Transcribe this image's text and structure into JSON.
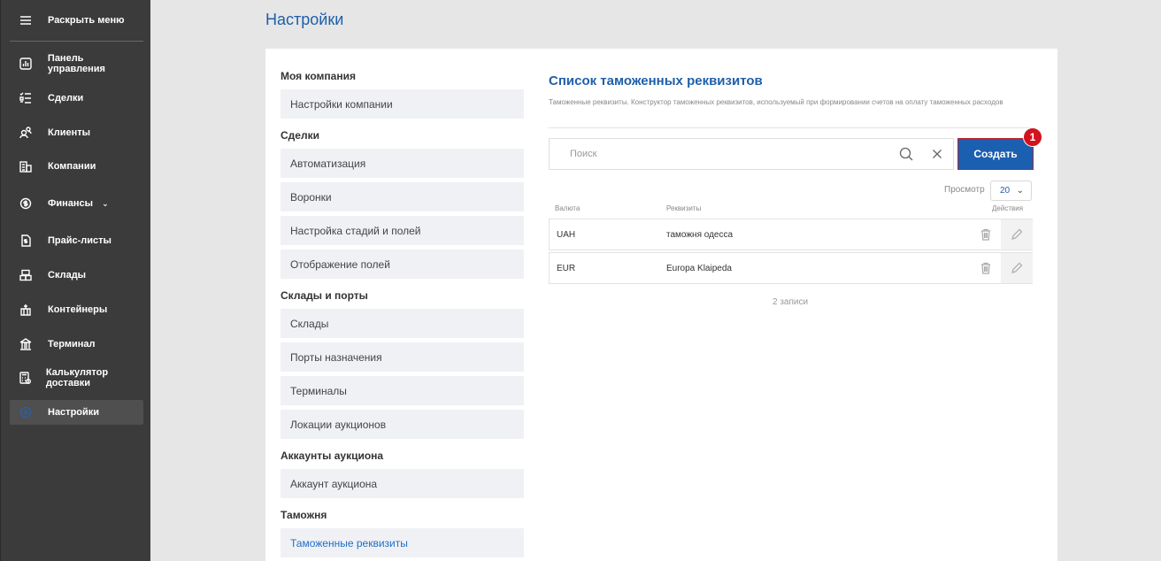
{
  "sidebar": {
    "toggle_label": "Раскрыть меню",
    "items": [
      {
        "label": "Панель управления",
        "icon": "dashboard-icon"
      },
      {
        "label": "Сделки",
        "icon": "deals-icon"
      },
      {
        "label": "Клиенты",
        "icon": "clients-icon"
      },
      {
        "label": "Компании",
        "icon": "companies-icon"
      },
      {
        "label": "Финансы",
        "icon": "finance-icon"
      },
      {
        "label": "Прайс-листы",
        "icon": "pricelist-icon"
      },
      {
        "label": "Склады",
        "icon": "warehouse-icon"
      },
      {
        "label": "Контейнеры",
        "icon": "containers-icon"
      },
      {
        "label": "Терминал",
        "icon": "terminal-icon"
      },
      {
        "label": "Калькулятор доставки",
        "icon": "calculator-icon"
      },
      {
        "label": "Настройки",
        "icon": "settings-icon"
      }
    ],
    "active": "Настройки",
    "accent_color": "#2f5fa6"
  },
  "page": {
    "title": "Настройки"
  },
  "settings_menu": {
    "groups": [
      {
        "title": "Моя компания",
        "items": [
          "Настройки компании"
        ]
      },
      {
        "title": "Сделки",
        "items": [
          "Автоматизация",
          "Воронки",
          "Настройка стадий и полей",
          "Отображение полей"
        ]
      },
      {
        "title": "Склады и порты",
        "items": [
          "Склады",
          "Порты назначения",
          "Терминалы",
          "Локации аукционов"
        ]
      },
      {
        "title": "Аккаунты аукциона",
        "items": [
          "Аккаунт аукциона"
        ]
      },
      {
        "title": "Таможня",
        "items": [
          "Таможенные реквизиты"
        ]
      }
    ],
    "active_item": "Таможенные реквизиты"
  },
  "customs": {
    "title": "Список таможенных реквизитов",
    "description": "Таможенные реквизиты. Конструктор таможенных реквизитов, используемый при формировании счетов на оплату таможенных расходов",
    "search_placeholder": "Поиск",
    "create_label": "Создать",
    "badge": "1",
    "view_label": "Просмотр",
    "page_size": "20",
    "columns": [
      "Валюта",
      "Реквизиты",
      "Действия"
    ],
    "rows": [
      {
        "currency": "UAH",
        "details": "таможня одесса"
      },
      {
        "currency": "EUR",
        "details": "Europa Klaipeda"
      }
    ],
    "records_label": "2 записи"
  },
  "colors": {
    "primary": "#1b5fb0",
    "badge": "#d2121f",
    "sidebar_bg": "#3b3b3b"
  }
}
